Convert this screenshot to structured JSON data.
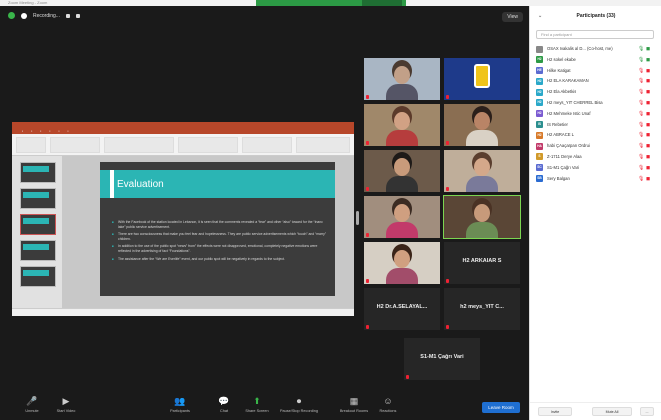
{
  "window": {
    "title": "Zoom Meeting - Zoom"
  },
  "topbar": {
    "recording": "Recording...",
    "view_label": "View"
  },
  "slide": {
    "title": "Evaluation",
    "bullets": [
      "With the Facebook of the station located in Lebanon, it is seen that the comments revealed a “fear” and other “also” toward for the “Inanc lake” public service advertisement.",
      "There are two consciousness that make you feel fear and hopelessness. They are public service advertisements which “touch” and “marry” children.",
      "In addition to the use of the public spot “news” from” the effects were not disapproved, emotional, completely negative emotions were reflected in the advertising of fact “Foundations”.",
      "The assistance after the “We are Everlife” event, and our public spot will be negatively in regards to the subject."
    ]
  },
  "tiles": [
    {
      "id": "t1",
      "name": "",
      "face": "#c2a088",
      "hair": "#4a3a30",
      "shirt": "#556",
      "bg": "#a9b6c4",
      "muted": true
    },
    {
      "id": "t2",
      "name": "",
      "face": "",
      "hair": "",
      "shirt": "",
      "bg": "#1e3a8a",
      "muted": true,
      "logo": true
    },
    {
      "id": "t3",
      "name": "",
      "face": "#d1a184",
      "hair": "#5b3a2a",
      "shirt": "#b63d3d",
      "bg": "#a0886a",
      "muted": true
    },
    {
      "id": "t4",
      "name": "",
      "face": "#b98466",
      "hair": "#2b1f1a",
      "shirt": "#d9d1c5",
      "bg": "#8a6e52",
      "muted": true
    },
    {
      "id": "t5",
      "name": "",
      "face": "#c89b7b",
      "hair": "#1e1a18",
      "shirt": "#333",
      "bg": "#6c5a4a",
      "muted": true
    },
    {
      "id": "t6",
      "name": "",
      "face": "#d4a88a",
      "hair": "#5a3e2e",
      "shirt": "#7a7a9a",
      "bg": "#bfae9a",
      "muted": true
    },
    {
      "id": "t7",
      "name": "",
      "face": "#cf9f80",
      "hair": "#3b2b22",
      "shirt": "#c23a6a",
      "bg": "#a18e7e",
      "muted": true
    },
    {
      "id": "t8",
      "name": "",
      "face": "#c79a7a",
      "hair": "#4a3224",
      "shirt": "#6b8c55",
      "bg": "#5a4636",
      "muted": false,
      "speaking": true
    },
    {
      "id": "t9",
      "name": "",
      "face": "#d0a080",
      "hair": "#3a2418",
      "shirt": "#a24d6a",
      "bg": "#d6cfc4",
      "muted": true
    },
    {
      "id": "t10",
      "bigname": "H2 ARKAIAR S",
      "muted": true
    },
    {
      "id": "t11",
      "bigname": "H2 Dr.A.SELAYAL...",
      "muted": true
    },
    {
      "id": "t12",
      "bigname": "h2 meys_YIT C...",
      "muted": true
    },
    {
      "id": "t13",
      "bigname": "S1-M1 Çağrı Vari",
      "muted": true
    }
  ],
  "toolbar": {
    "items": [
      {
        "key": "mute",
        "icon": "🎤",
        "label": "Unmute"
      },
      {
        "key": "video",
        "icon": "▶",
        "label": "Start Video"
      },
      {
        "key": "participants",
        "icon": "👥",
        "label": "Participants"
      },
      {
        "key": "chat",
        "icon": "💬",
        "label": "Chat"
      },
      {
        "key": "share",
        "icon": "⬆",
        "label": "Share Screen"
      },
      {
        "key": "record",
        "icon": "⏺",
        "label": "Pause/Stop Recording"
      },
      {
        "key": "breakout",
        "icon": "▦",
        "label": "Breakout Rooms"
      },
      {
        "key": "reactions",
        "icon": "☺",
        "label": "Reactions"
      }
    ],
    "leave_label": "Leave Room"
  },
  "panel": {
    "title": "Participants (33)",
    "search_placeholder": "Find a participant",
    "participants": [
      {
        "initials": "",
        "name": "OSAX Ivakalis al D... (Co-host, me)",
        "color": "#888",
        "mic": "on",
        "cam": "on"
      },
      {
        "initials": "H2",
        "name": "H2 sokel ekabe",
        "color": "#2c9a45",
        "mic": "on",
        "cam": "on"
      },
      {
        "initials": "HE",
        "name": "Hilke Katigat",
        "color": "#5a6bd1",
        "mic": "off",
        "cam": "off"
      },
      {
        "initials": "H2",
        "name": "H2 ELA KARAKAMAN",
        "color": "#2aa8c9",
        "mic": "off",
        "cam": "off"
      },
      {
        "initials": "H2",
        "name": "H2 Ela Akbetkis",
        "color": "#2aa8c9",
        "mic": "off",
        "cam": "off"
      },
      {
        "initials": "H2",
        "name": "H2 meys_YIT CHERREL Bisa",
        "color": "#2aa8c9",
        "mic": "off",
        "cam": "off"
      },
      {
        "initials": "H2",
        "name": "H2 Mehmeke Istic Unaf",
        "color": "#7a5ad1",
        "mic": "off",
        "cam": "off"
      },
      {
        "initials": "IS",
        "name": "IS Rebetier",
        "color": "#2c8f8f",
        "mic": "off",
        "cam": "off"
      },
      {
        "initials": "H2",
        "name": "H2 ABRACE L",
        "color": "#d87a2a",
        "mic": "off",
        "cam": "off"
      },
      {
        "initials": "HA",
        "name": "habi ÇAaçarpan Ordrui",
        "color": "#c23a6a",
        "mic": "off",
        "cam": "off"
      },
      {
        "initials": "S",
        "name": "Z-1711 Derye Alaa",
        "color": "#d19a2a",
        "mic": "off",
        "cam": "off"
      },
      {
        "initials": "SC",
        "name": "S1-M1 Çağrı Vari",
        "color": "#5a6bd1",
        "mic": "off",
        "cam": "off"
      },
      {
        "initials": "SB",
        "name": "Sery Balgan",
        "color": "#2a6bd1",
        "mic": "off",
        "cam": "off"
      }
    ],
    "footer": {
      "invite": "Invite",
      "mute_all": "Mute All",
      "more": "..."
    }
  },
  "colors": {
    "accent": "#2bb5b4",
    "ppt": "#b7472a",
    "leave": "#1f6fd1",
    "muted": "#e22233",
    "active": "#2c9a45"
  }
}
